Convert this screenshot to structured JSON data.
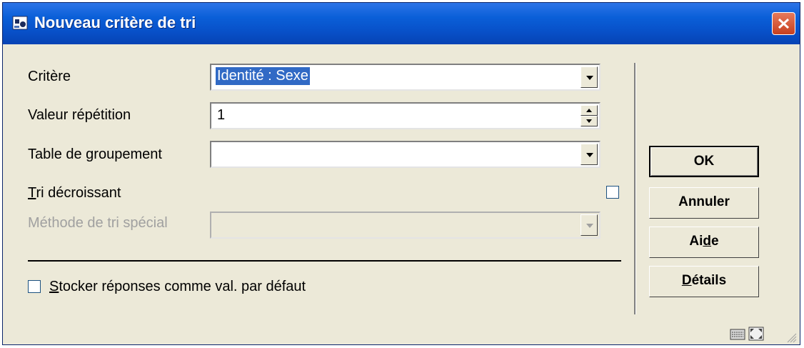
{
  "window": {
    "title": "Nouveau critère de tri"
  },
  "form": {
    "critere": {
      "label": "Critère",
      "value": "Identité : Sexe"
    },
    "valeur_repetition": {
      "label": "Valeur répétition",
      "value": "1"
    },
    "table_groupement": {
      "label": "Table de groupement",
      "value": ""
    },
    "tri_decroissant": {
      "label_first": "T",
      "label_rest": "ri décroissant",
      "checked": false
    },
    "methode_tri_special": {
      "label": "Méthode de tri spécial",
      "value": "",
      "disabled": true
    },
    "stocker": {
      "label_first": "S",
      "label_rest": "tocker réponses comme val. par défaut",
      "checked": false
    }
  },
  "buttons": {
    "ok": "OK",
    "annuler": "Annuler",
    "aide_pre": "Ai",
    "aide_u": "d",
    "aide_post": "e",
    "details_u": "D",
    "details_rest": "étails"
  },
  "icons": {
    "title": "app-dialog-icon",
    "close": "close-icon",
    "status": [
      "keyboard-icon",
      "fullscreen-icon",
      "resize-grip-icon"
    ]
  },
  "colors": {
    "titlebar": "#0a5fd8",
    "dialog_bg": "#ece9d8",
    "selection": "#316ac5",
    "close": "#c8401f"
  }
}
